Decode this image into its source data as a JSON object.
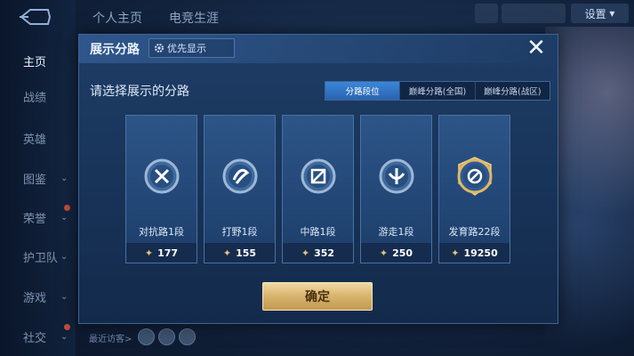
{
  "background": {
    "top_tabs": [
      "个人主页",
      "电竞生涯"
    ],
    "settings_label": "设置",
    "sidebar": [
      {
        "label": "主页",
        "active": true,
        "chevron": false,
        "badge": false
      },
      {
        "label": "战绩",
        "active": false,
        "chevron": false,
        "badge": false
      },
      {
        "label": "英雄",
        "active": false,
        "chevron": false,
        "badge": false
      },
      {
        "label": "图鉴",
        "active": false,
        "chevron": true,
        "badge": false
      },
      {
        "label": "荣誉",
        "active": false,
        "chevron": true,
        "badge": true
      },
      {
        "label": "护卫队",
        "active": false,
        "chevron": true,
        "badge": false
      },
      {
        "label": "游戏",
        "active": false,
        "chevron": true,
        "badge": false
      },
      {
        "label": "社交",
        "active": false,
        "chevron": true,
        "badge": true
      }
    ],
    "recent_visitors_label": "最近访客>"
  },
  "modal": {
    "title": "展示分路",
    "priority_label": "优先显示",
    "prompt": "请选择展示的分路",
    "filters": [
      {
        "label": "分路段位",
        "active": true
      },
      {
        "label": "巅峰分路(全国)",
        "active": false
      },
      {
        "label": "巅峰分路(战区)",
        "active": false
      }
    ],
    "lanes": [
      {
        "label": "对抗路1段",
        "value": "177",
        "icon": "clash-lane-emblem-icon"
      },
      {
        "label": "打野1段",
        "value": "155",
        "icon": "jungle-emblem-icon"
      },
      {
        "label": "中路1段",
        "value": "352",
        "icon": "mid-lane-emblem-icon"
      },
      {
        "label": "游走1段",
        "value": "250",
        "icon": "roam-emblem-icon"
      },
      {
        "label": "发育路22段",
        "value": "19250",
        "icon": "farm-lane-gold-emblem-icon"
      }
    ],
    "confirm_label": "确定"
  },
  "colors": {
    "accent_blue": "#2a63b0",
    "gold": "#d7b36d",
    "modal_bg": "#1e3d66"
  }
}
